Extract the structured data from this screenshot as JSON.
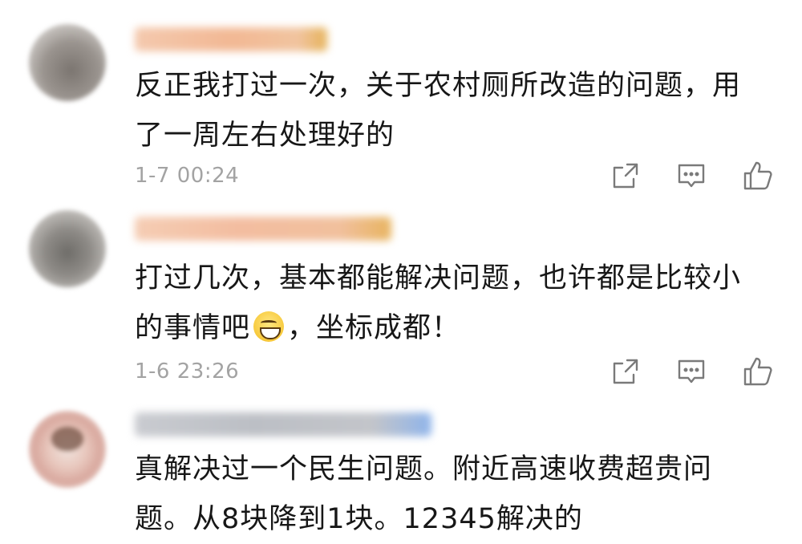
{
  "comments": [
    {
      "text_line1": "反正我打过一次，关于农村厕所改造的问题，用",
      "text_line2": "了一周左右处理好的",
      "time": "1-7 00:24",
      "icons": [
        "share-icon",
        "comment-icon",
        "like-icon"
      ]
    },
    {
      "text_line1": "打过几次，基本都能解决问题，也许都是比较小",
      "text_line2_before": "的事情吧",
      "text_line2_after": "，坐标成都！",
      "emoji": "grinning-emoji",
      "time": "1-6 23:26",
      "icons": [
        "share-icon",
        "comment-icon",
        "like-icon"
      ]
    },
    {
      "text_line1": "真解决过一个民生问题。附近高速收费超贵问",
      "text_line2": "题。从8块降到1块。12345解决的"
    }
  ],
  "colors": {
    "text": "#171717",
    "meta": "#a3a3a3",
    "icon": "#7a7a7a"
  }
}
